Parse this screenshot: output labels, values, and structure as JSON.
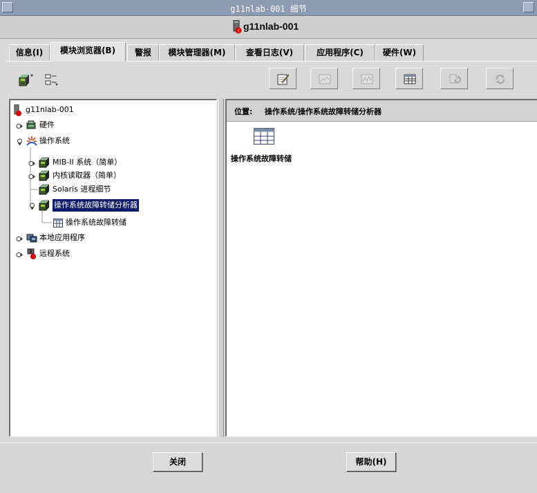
{
  "window": {
    "title": "g11nlab-001 细节"
  },
  "header": {
    "host": "g11nlab-001"
  },
  "tabs": [
    {
      "label": "信息(I)"
    },
    {
      "label": "模块浏览器(B)"
    },
    {
      "label": "警报"
    },
    {
      "label": "模块管理器(M)"
    },
    {
      "label": "查看日志(V)"
    },
    {
      "label": "应用程序(C)"
    },
    {
      "label": "硬件(W)"
    }
  ],
  "active_tab": "模块浏览器(B)",
  "toolbar": {
    "left_icons": [
      "hierarchy-view-icon",
      "topology-view-icon"
    ],
    "right_buttons": [
      {
        "icon": "edit-properties-icon",
        "enabled": true
      },
      {
        "icon": "graph-icon",
        "enabled": false
      },
      {
        "icon": "chart-icon",
        "enabled": false
      },
      {
        "icon": "table-view-icon",
        "enabled": true
      },
      {
        "icon": "refresh-icon",
        "enabled": false
      },
      {
        "icon": "sync-icon",
        "enabled": false
      }
    ]
  },
  "tree": {
    "root": "g11nlab-001",
    "hardware": "硬件",
    "os": "操作系统",
    "mib2": "MIB-II 系统（简单）",
    "kernel_reader": "内核读取器（简单）",
    "solaris_process": "Solaris 进程细节",
    "crash_analyzer": "操作系统故障转储分析器",
    "crash_dump": "操作系统故障转储",
    "local_apps": "本地应用程序",
    "remote_systems": "远程系统"
  },
  "location": {
    "label": "位置:",
    "path": "操作系统/操作系统故障转储分析器"
  },
  "content": {
    "item_label": "操作系统故障转储"
  },
  "buttons": {
    "close": "关闭",
    "help": "帮助(H)"
  }
}
